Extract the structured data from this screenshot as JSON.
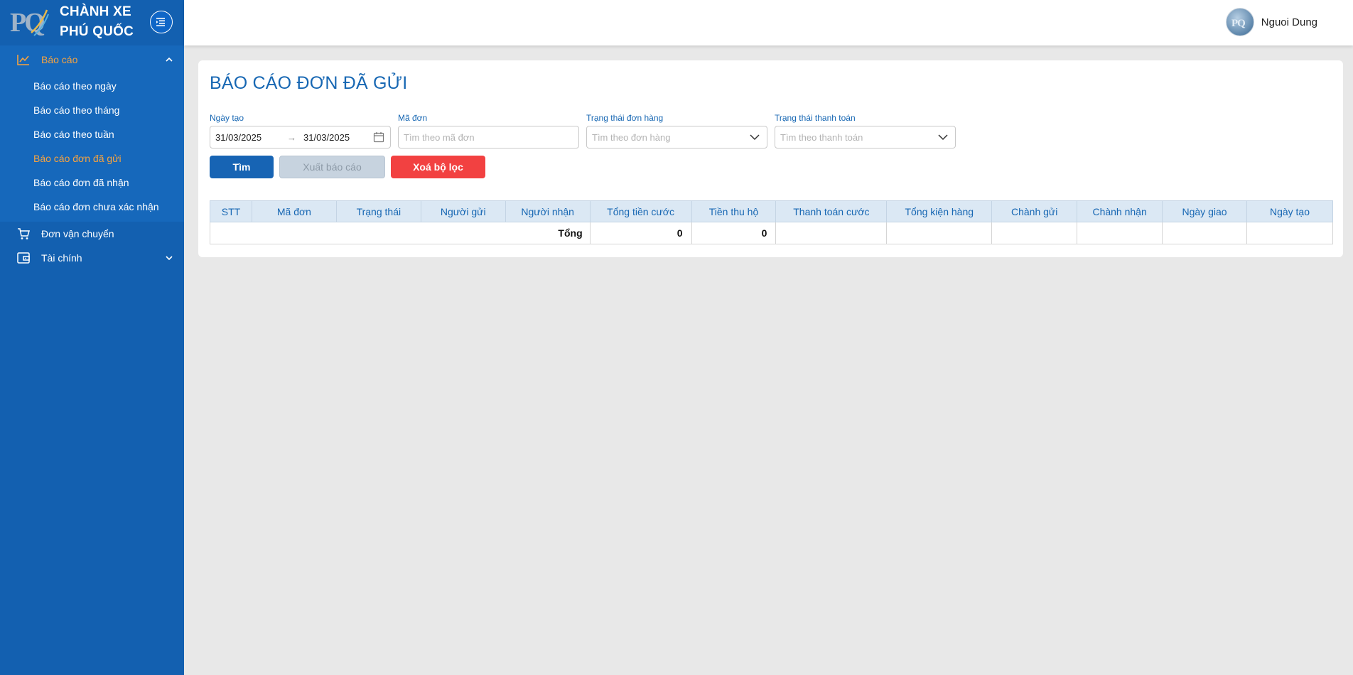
{
  "brand": {
    "line1": "CHÀNH XE",
    "line2": "PHÚ QUỐC",
    "logo_text": "PQ"
  },
  "sidebar": {
    "groups": [
      {
        "label": "Báo cáo",
        "icon": "line-chart-icon",
        "expanded": true,
        "items": [
          {
            "label": "Báo cáo theo ngày"
          },
          {
            "label": "Báo cáo theo tháng"
          },
          {
            "label": "Báo cáo theo tuần"
          },
          {
            "label": "Báo cáo đơn đã gửi"
          },
          {
            "label": "Báo cáo đơn đã nhận"
          },
          {
            "label": "Báo cáo đơn chưa xác nhận"
          }
        ]
      },
      {
        "label": "Đơn vận chuyển",
        "icon": "cart-icon"
      },
      {
        "label": "Tài chính",
        "icon": "wallet-icon"
      }
    ]
  },
  "header": {
    "user_name": "Nguoi Dung"
  },
  "main": {
    "title": "BÁO CÁO ĐƠN ĐÃ GỬI",
    "filters": {
      "date_label": "Ngày tạo",
      "date_from": "31/03/2025",
      "date_to": "31/03/2025",
      "code_label": "Mã đơn",
      "code_placeholder": "Tìm theo mã đơn",
      "order_status_label": "Trạng thái đơn hàng",
      "order_status_placeholder": "Tìm theo đơn hàng",
      "payment_status_label": "Trạng thái thanh toán",
      "payment_status_placeholder": "Tìm theo thanh toán"
    },
    "buttons": {
      "find": "Tìm",
      "export": "Xuất báo cáo",
      "clear": "Xoá bộ lọc"
    },
    "table": {
      "columns": [
        "STT",
        "Mã đơn",
        "Trạng thái",
        "Người gửi",
        "Người nhận",
        "Tổng tiền cước",
        "Tiền thu hộ",
        "Thanh toán cước",
        "Tổng kiện hàng",
        "Chành gửi",
        "Chành nhận",
        "Ngày giao",
        "Ngày tạo"
      ],
      "total_label": "Tổng",
      "total_fee": "0",
      "total_cod": "0"
    }
  },
  "colors": {
    "sidebar_bg": "#1360b0",
    "accent_orange": "#f6a340",
    "primary_blue": "#1767b3",
    "danger_red": "#f24141"
  }
}
